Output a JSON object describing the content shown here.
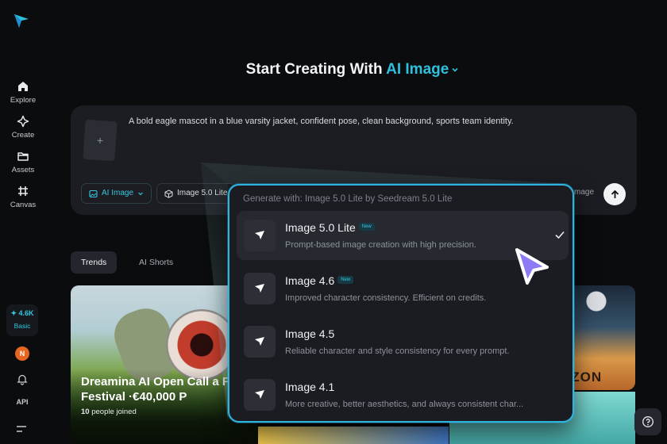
{
  "sidebar": {
    "items": [
      {
        "label": "Explore",
        "icon": "home-icon"
      },
      {
        "label": "Create",
        "icon": "sparkle-icon"
      },
      {
        "label": "Assets",
        "icon": "folder-icon"
      },
      {
        "label": "Canvas",
        "icon": "canvas-icon"
      }
    ],
    "credits": "✦ 4.6K",
    "plan": "Basic",
    "avatar_initial": "N",
    "api_label": "API"
  },
  "heading": {
    "prefix": "Start Creating With ",
    "mode": "AI Image"
  },
  "prompt": {
    "text": "A bold eagle mascot in a blue varsity jacket, confident pose, clean background, sports team identity.",
    "type_chip": "AI Image",
    "model_chip": "Image 5.0 Lite",
    "trailing_text": "mage",
    "upload_symbol": "+"
  },
  "tabs": [
    {
      "label": "Trends",
      "active": true
    },
    {
      "label": "AI Shorts",
      "active": false
    }
  ],
  "feed": {
    "card_title": "Dreamina AI Open Call a Film Festival ·€40,000 P",
    "joined_count": "10",
    "joined_text": " people joined",
    "horizon_text": "ORIZON"
  },
  "dropdown": {
    "header": "Generate with: Image 5.0 Lite by Seedream 5.0 Lite",
    "options": [
      {
        "name": "Image 5.0 Lite",
        "badge": "New",
        "desc": "Prompt-based image creation with high precision.",
        "selected": true
      },
      {
        "name": "Image 4.6",
        "badge": "New",
        "desc": "Improved character consistency. Efficient on credits.",
        "selected": false
      },
      {
        "name": "Image 4.5",
        "badge": "",
        "desc": "Reliable character and style consistency for every prompt.",
        "selected": false
      },
      {
        "name": "Image 4.1",
        "badge": "",
        "desc": "More creative, better aesthetics, and always consistent char...",
        "selected": false
      }
    ]
  },
  "colors": {
    "accent": "#2fc0dc",
    "dropdown_border": "#2fb3e0",
    "avatar": "#e8651f",
    "cursor": "#8b7cf6"
  }
}
